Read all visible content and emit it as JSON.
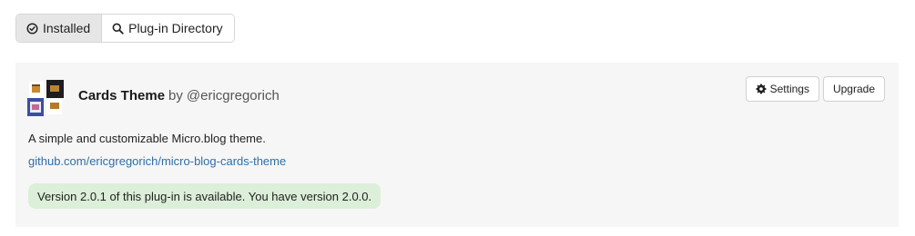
{
  "tabs": [
    {
      "label": "Installed",
      "icon": "check-circle-icon",
      "active": true
    },
    {
      "label": "Plug-in Directory",
      "icon": "search-icon",
      "active": false
    }
  ],
  "plugin": {
    "name": "Cards Theme",
    "by": "by",
    "author": "@ericgregorich",
    "description": "A simple and customizable Micro.blog theme.",
    "link": "github.com/ericgregorich/micro-blog-cards-theme",
    "update_notice": "Version 2.0.1 of this plug-in is available. You have version 2.0.0."
  },
  "actions": {
    "settings_label": "Settings",
    "upgrade_label": "Upgrade"
  },
  "colors": {
    "link": "#2f6fa6",
    "notice_bg": "#dcefd9",
    "card_bg": "#f6f6f6",
    "active_tab_bg": "#e6e6e6"
  }
}
